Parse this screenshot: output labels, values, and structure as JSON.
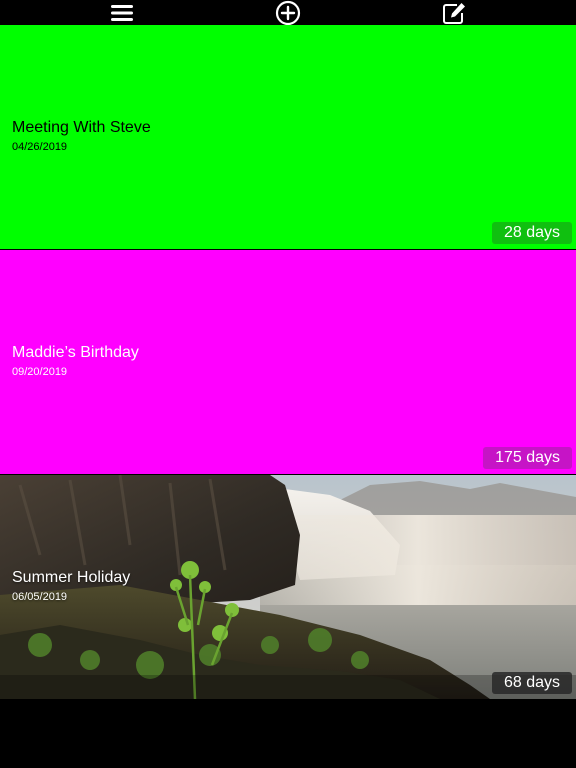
{
  "toolbar": {
    "icons": [
      "menu-icon",
      "add-circle-icon",
      "edit-icon"
    ]
  },
  "events": [
    {
      "title": "Meeting With Steve",
      "date": "04/26/2019",
      "days": "28 days",
      "background": "#00ff00",
      "badge_color": "#0fbf0f",
      "text_color": "#000000"
    },
    {
      "title": "Maddie’s Birthday",
      "date": "09/20/2019",
      "days": "175 days",
      "background": "#ff00ff",
      "badge_color": "#c814c8",
      "text_color": "#ffffff"
    },
    {
      "title": "Summer Holiday",
      "date": "06/05/2019",
      "days": "68 days",
      "background": "waterfall-photo",
      "badge_color": "#3a3a3a",
      "text_color": "#ffffff"
    }
  ]
}
